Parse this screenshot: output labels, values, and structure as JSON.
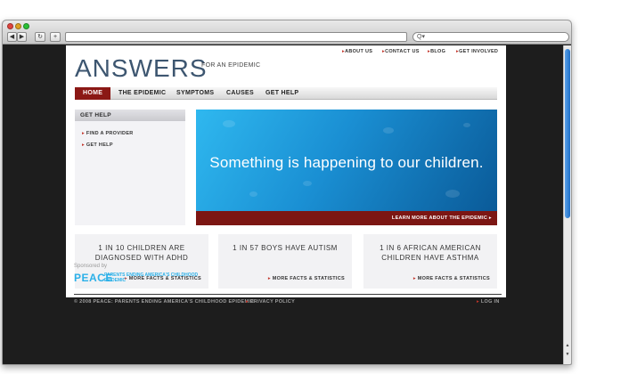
{
  "browser": {
    "back_glyph": "◀",
    "forward_glyph": "▶",
    "reload_glyph": "↻",
    "add_glyph": "+",
    "search_glyph": "Q▾",
    "url": "",
    "scroll_up_glyph": "▲",
    "scroll_down_glyph": "▼"
  },
  "site": {
    "logo": "ANSWERS",
    "tagline": "FOR AN EPIDEMIC",
    "utility_nav": [
      "ABOUT US",
      "CONTACT US",
      "BLOG",
      "GET INVOLVED"
    ],
    "main_nav": [
      {
        "label": "HOME",
        "active": true
      },
      {
        "label": "THE EPIDEMIC",
        "active": false
      },
      {
        "label": "SYMPTOMS",
        "active": false
      },
      {
        "label": "CAUSES",
        "active": false
      },
      {
        "label": "GET HELP",
        "active": false
      }
    ],
    "sidebar": {
      "heading": "GET HELP",
      "links": [
        "FIND A PROVIDER",
        "GET HELP"
      ]
    },
    "hero": {
      "headline": "Something is happening to our children.",
      "cta": "LEARN MORE ABOUT THE EPIDEMIC ▸"
    },
    "cards": [
      {
        "title": "1 IN 10 CHILDREN ARE DIAGNOSED WITH ADHD",
        "link": "MORE FACTS & STATISTICS"
      },
      {
        "title": "1 IN 57 BOYS HAVE AUTISM",
        "link": "MORE FACTS & STATISTICS"
      },
      {
        "title": "1 IN 6 AFRICAN AMERICAN CHILDREN HAVE ASTHMA",
        "link": "MORE FACTS & STATISTICS"
      }
    ],
    "footer": {
      "sponsored_by": "Sponsored by",
      "sponsor_name": "PEACE",
      "sponsor_sub": "PARENTS ENDING AMERICA'S CHILDHOOD EPIDEMIC",
      "copyright": "© 2008 PEACE: PARENTS ENDING AMERICA'S CHILDHOOD EPIDEMIC",
      "privacy": "PRIVACY POLICY",
      "login": "LOG IN"
    },
    "colors": {
      "accent_red": "#8b1815",
      "logo_blue": "#3d5670",
      "hero_blue": "#1a8fd3",
      "sponsor_blue": "#2bb0e8"
    }
  }
}
